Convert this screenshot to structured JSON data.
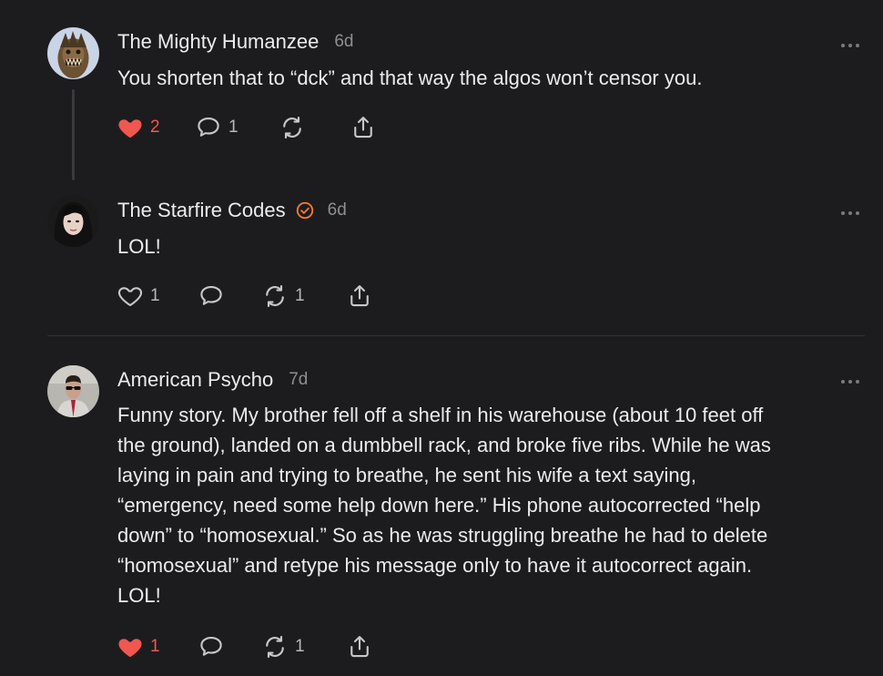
{
  "colors": {
    "background": "#1c1c1e",
    "like": "#f0574f",
    "verified": "#ff7a2f",
    "muted": "#8e8e93"
  },
  "posts": [
    {
      "author": "The Mighty Humanzee",
      "time": "6d",
      "verified": false,
      "text": "You shorten that to “dck” and that way the algos won’t censor you.",
      "likes": "2",
      "liked": true,
      "replies": "1",
      "reposts": "",
      "icons": [
        "heart-filled-icon",
        "comment-icon",
        "repost-icon",
        "share-icon",
        "more-icon"
      ]
    },
    {
      "author": "The Starfire Codes",
      "time": "6d",
      "verified": true,
      "text": "LOL!",
      "likes": "1",
      "liked": false,
      "replies": "",
      "reposts": "1",
      "icons": [
        "heart-outline-icon",
        "comment-icon",
        "repost-icon",
        "share-icon",
        "more-icon"
      ]
    },
    {
      "author": "American Psycho",
      "time": "7d",
      "verified": false,
      "text_lines": [
        "Funny story. My brother fell off a shelf in his warehouse (about 10 feet off",
        "the ground), landed on a dumbbell rack, and broke five ribs. While he was",
        "laying in pain and trying to breathe, he sent his wife a text saying,",
        "“emergency, need some help down here.” His phone autocorrected “help",
        "down” to “homosexual.” So as he was struggling breathe he had to delete",
        "“homosexual” and retype his message only to have it autocorrect again.",
        "LOL!"
      ],
      "likes": "1",
      "liked": true,
      "replies": "",
      "reposts": "1",
      "icons": [
        "heart-filled-icon",
        "comment-icon",
        "repost-icon",
        "share-icon",
        "more-icon"
      ]
    }
  ]
}
